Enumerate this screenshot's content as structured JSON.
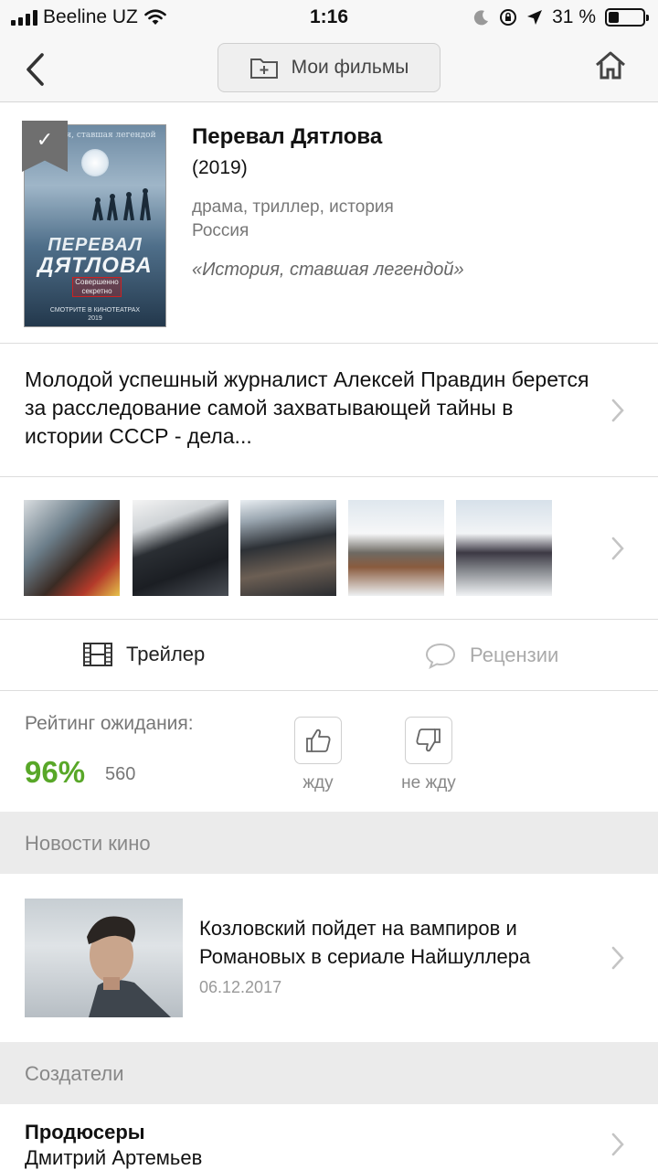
{
  "status_bar": {
    "carrier": "Beeline UZ",
    "time": "1:16",
    "battery_text": "31 %",
    "battery_level": 0.31
  },
  "navbar": {
    "title": "Мои фильмы",
    "back_icon": "chevron-left-icon",
    "folder_icon": "folder-plus-icon",
    "home_icon": "home-icon"
  },
  "movie": {
    "title": "Перевал Дятлова",
    "year": "(2019)",
    "genres": "драма, триллер, история",
    "country": "Россия",
    "tagline": "«История, ставшая легендой»",
    "bookmark_icon": "checkmark-icon",
    "poster": {
      "top_text": "История, ставшая легендой",
      "title_line1": "ПЕРЕВАЛ",
      "title_line2": "ДЯТЛОВА",
      "stamp": "Совершенно секретно",
      "bottom_line1": "СМОТРИТЕ В КИНОТЕАТРАХ",
      "bottom_line2": "2019"
    }
  },
  "description": {
    "text": "Молодой успешный журналист Алексей Правдин берется за расследование самой захватывающей тайны в истории СССР - дела..."
  },
  "actions": {
    "trailer_label": "Трейлер",
    "reviews_label": "Рецензии",
    "trailer_icon": "film-icon",
    "reviews_icon": "speech-bubble-icon"
  },
  "rating": {
    "label": "Рейтинг ожидания:",
    "percent": "96%",
    "count": "560",
    "like_label": "жду",
    "dislike_label": "не жду",
    "accent_color": "#58a728"
  },
  "sections": {
    "news": "Новости кино",
    "creators": "Создатели"
  },
  "news": {
    "title": "Козловский пойдет на вампиров и Романовых в сериале Найшуллера",
    "date": "06.12.2017"
  },
  "creators": {
    "role": "Продюсеры",
    "name": "Дмитрий Артемьев"
  }
}
